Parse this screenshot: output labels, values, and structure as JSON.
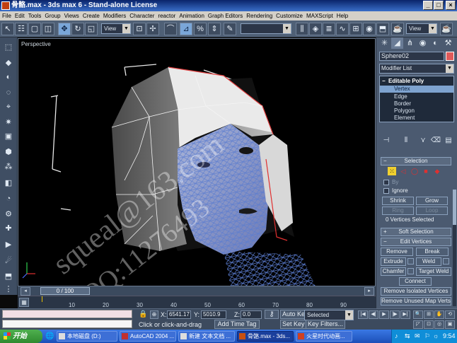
{
  "window": {
    "title": "骨骼.max - 3ds max 6 - Stand-alone License"
  },
  "menu": [
    "File",
    "Edit",
    "Tools",
    "Group",
    "Views",
    "Create",
    "Modifiers",
    "Character",
    "reactor",
    "Animation",
    "Graph Editors",
    "Rendering",
    "Customize",
    "MAXScript",
    "Help"
  ],
  "toolbar": {
    "ref_coord_label": "View",
    "named_selection": "",
    "view_dropdown_right": "View"
  },
  "viewport": {
    "label": "Perspective"
  },
  "time": {
    "slider_label": "0 / 100",
    "ruler_ticks": [
      "10",
      "20",
      "30",
      "40",
      "50",
      "60",
      "70",
      "80",
      "90"
    ]
  },
  "status": {
    "x_label": "X:",
    "x_value": "6541.17",
    "y_label": "Y:",
    "y_value": "5010.9",
    "z_label": "Z:",
    "z_value": "0.0",
    "prompt": "Click or click-and-drag",
    "add_time_tag": "Add Time Tag",
    "auto_key": "Auto Key",
    "set_key": "Set Key",
    "key_filters": "Key Filters...",
    "selected": "Selected"
  },
  "command_panel": {
    "object_name": "Sphere02",
    "object_color": "#e05a5a",
    "modifier_list": "Modifier List",
    "stack": {
      "modifier": "Editable Poly",
      "items": [
        "Vertex",
        "Edge",
        "Border",
        "Polygon",
        "Element"
      ],
      "selected_index": 0
    },
    "selection_rollout": {
      "title": "Selection",
      "by_vertex": "By",
      "ignore": "Ignore",
      "shrink": "Shrink",
      "grow": "Grow",
      "ring": "Ring",
      "loop": "Loop",
      "info": "0 Vertices Selected"
    },
    "soft_selection_rollout": {
      "title": "Soft Selection"
    },
    "edit_vertices_rollout": {
      "title": "Edit Vertices",
      "remove": "Remove",
      "break": "Break",
      "extrude": "Extrude",
      "weld": "Weld",
      "chamfer": "Chamfer",
      "target_weld": "Target Weld",
      "connect": "Connect",
      "remove_isolated": "Remove Isolated Vertices",
      "remove_unused": "Remove Unused Map Verts"
    }
  },
  "taskbar": {
    "start_label": "开始",
    "tasks": [
      {
        "label": "本地磁盘 (D:)"
      },
      {
        "label": "AutoCAD 2004 ..."
      },
      {
        "label": "新建 文本文档 ..."
      },
      {
        "label": "骨骼.max - 3ds..."
      },
      {
        "label": "火星时代动画..."
      }
    ],
    "clock": "9:54"
  },
  "watermark": {
    "line1": "squeal@163.com",
    "line2": "QQ:11276493"
  },
  "colors": {
    "title_bar": "#0a246a",
    "ui_panel": "#4b5a70",
    "selected_subobject": "#7ea3cf",
    "viewport_bg": "#000000",
    "mesh_wire": "#6f8fd8",
    "helmet_surface": "#d8d8d8"
  }
}
